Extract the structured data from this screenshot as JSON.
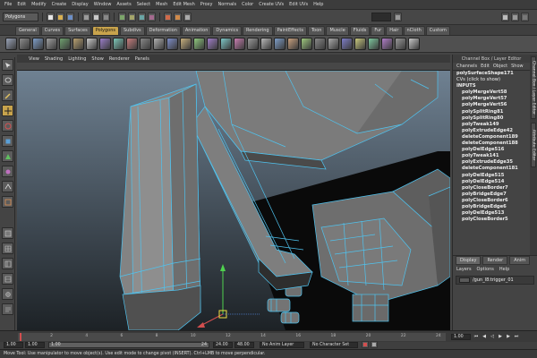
{
  "menubar": {
    "items": [
      "File",
      "Edit",
      "Modify",
      "Create",
      "Display",
      "Window",
      "Assets",
      "Select",
      "Mesh",
      "Edit Mesh",
      "Proxy",
      "Normals",
      "Color",
      "Create UVs",
      "Edit UVs",
      "Help"
    ]
  },
  "status_line": {
    "mode": "Polygons"
  },
  "shelf": {
    "tabs": [
      "General",
      "Curves",
      "Surfaces",
      "Polygons",
      "Subdivs",
      "Deformation",
      "Animation",
      "Dynamics",
      "Rendering",
      "PaintEffects",
      "Toon",
      "Muscle",
      "Fluids",
      "Fur",
      "Hair",
      "nCloth",
      "Custom"
    ],
    "active_index": 3
  },
  "viewport": {
    "menu": [
      "View",
      "Shading",
      "Lighting",
      "Show",
      "Renderer",
      "Panels"
    ]
  },
  "channel_box": {
    "header": "Channel Box / Layer Editor",
    "menu": [
      "Channels",
      "Edit",
      "Object",
      "Show"
    ],
    "shape": "polySurfaceShape171",
    "cvs": "CVs (click to show)",
    "inputs_label": "INPUTS",
    "inputs": [
      "polyMergeVert58",
      "polyMergeVert57",
      "polyMergeVert56",
      "polySplitRing81",
      "polySplitRing80",
      "polyTweak149",
      "polyExtrudeEdge42",
      "deleteComponent189",
      "deleteComponent188",
      "polyDelEdge516",
      "polyTweak141",
      "polyExtrudeEdge35",
      "deleteComponent181",
      "polyDelEdge515",
      "polyDelEdge514",
      "polyCloseBorder7",
      "polyBridgeEdge7",
      "polyCloseBorder6",
      "polyBridgeEdge6",
      "polyDelEdge513",
      "polyCloseBorder5"
    ]
  },
  "side_tabs": [
    "Channel Box / Layer Editor",
    "Attribute Editor"
  ],
  "layer_editor": {
    "tabs": [
      "Display",
      "Render",
      "Anim"
    ],
    "active_tab": 0,
    "menu": [
      "Layers",
      "Options",
      "Help"
    ],
    "layers": [
      {
        "name": "/gun_l8:trigger_01"
      }
    ]
  },
  "time_slider": {
    "start": "1.00",
    "current_start": "1.00",
    "playback_start": "1.00",
    "range_start": "1.00",
    "range_end_marker": "24",
    "playback_end": "24.00",
    "end": "48.00",
    "anim_layer": "No Anim Layer",
    "character_set": "No Character Set",
    "ticks": [
      "2",
      "4",
      "6",
      "8",
      "10",
      "12",
      "14",
      "16",
      "18",
      "20",
      "22",
      "24"
    ]
  },
  "help_line": "Move Tool: Use manipulator to move object(s). Use edit mode to change pivot (INSERT). Ctrl+LMB to move perpendicular.",
  "colors": {
    "accent": "#c8a34c",
    "wire": "#4fc3ef",
    "mesh": "#7a7a7a"
  }
}
